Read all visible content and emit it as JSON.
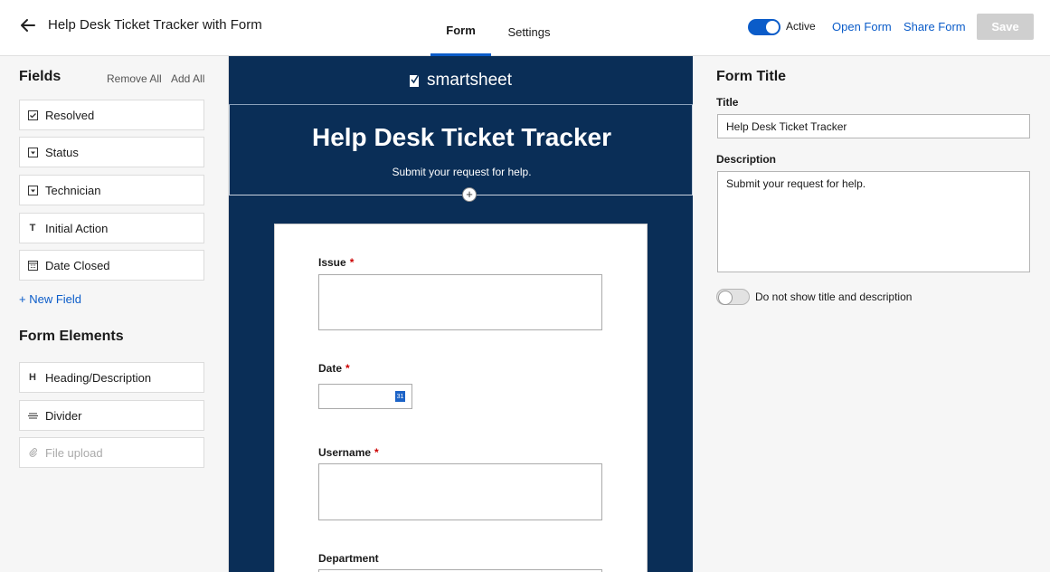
{
  "header": {
    "title": "Help Desk Ticket Tracker with Form",
    "tabs": [
      {
        "label": "Form"
      },
      {
        "label": "Settings"
      }
    ],
    "active_label": "Active",
    "active_on": true,
    "open_form": "Open Form",
    "share_form": "Share Form",
    "save": "Save"
  },
  "fields_panel": {
    "title": "Fields",
    "remove_all": "Remove All",
    "add_all": "Add All",
    "fields": [
      {
        "label": "Resolved",
        "icon": "checkbox-icon"
      },
      {
        "label": "Status",
        "icon": "dropdown-icon"
      },
      {
        "label": "Technician",
        "icon": "dropdown-icon"
      },
      {
        "label": "Initial Action",
        "icon": "text-icon"
      },
      {
        "label": "Date Closed",
        "icon": "calendar-icon"
      }
    ],
    "new_field": "+ New Field",
    "elements_title": "Form Elements",
    "elements": [
      {
        "label": "Heading/Description",
        "icon": "heading-icon"
      },
      {
        "label": "Divider",
        "icon": "divider-icon"
      },
      {
        "label": "File upload",
        "icon": "paperclip-icon"
      }
    ]
  },
  "preview": {
    "logo_text": "smartsheet",
    "banner_title": "Help Desk Ticket Tracker",
    "banner_desc": "Submit your request for help.",
    "questions": [
      {
        "label": "Issue",
        "required": "*"
      },
      {
        "label": "Date",
        "required": "*"
      },
      {
        "label": "Username",
        "required": "*"
      },
      {
        "label": "Department"
      }
    ],
    "colors": {
      "background": "#0a2e57",
      "accent": "#0b5cc9"
    }
  },
  "form_title_panel": {
    "title": "Form Title",
    "title_label": "Title",
    "title_value": "Help Desk Ticket Tracker",
    "desc_label": "Description",
    "desc_value": "Submit your request for help.",
    "hide_toggle_label": "Do not show title and description",
    "hide_toggle_on": false
  }
}
